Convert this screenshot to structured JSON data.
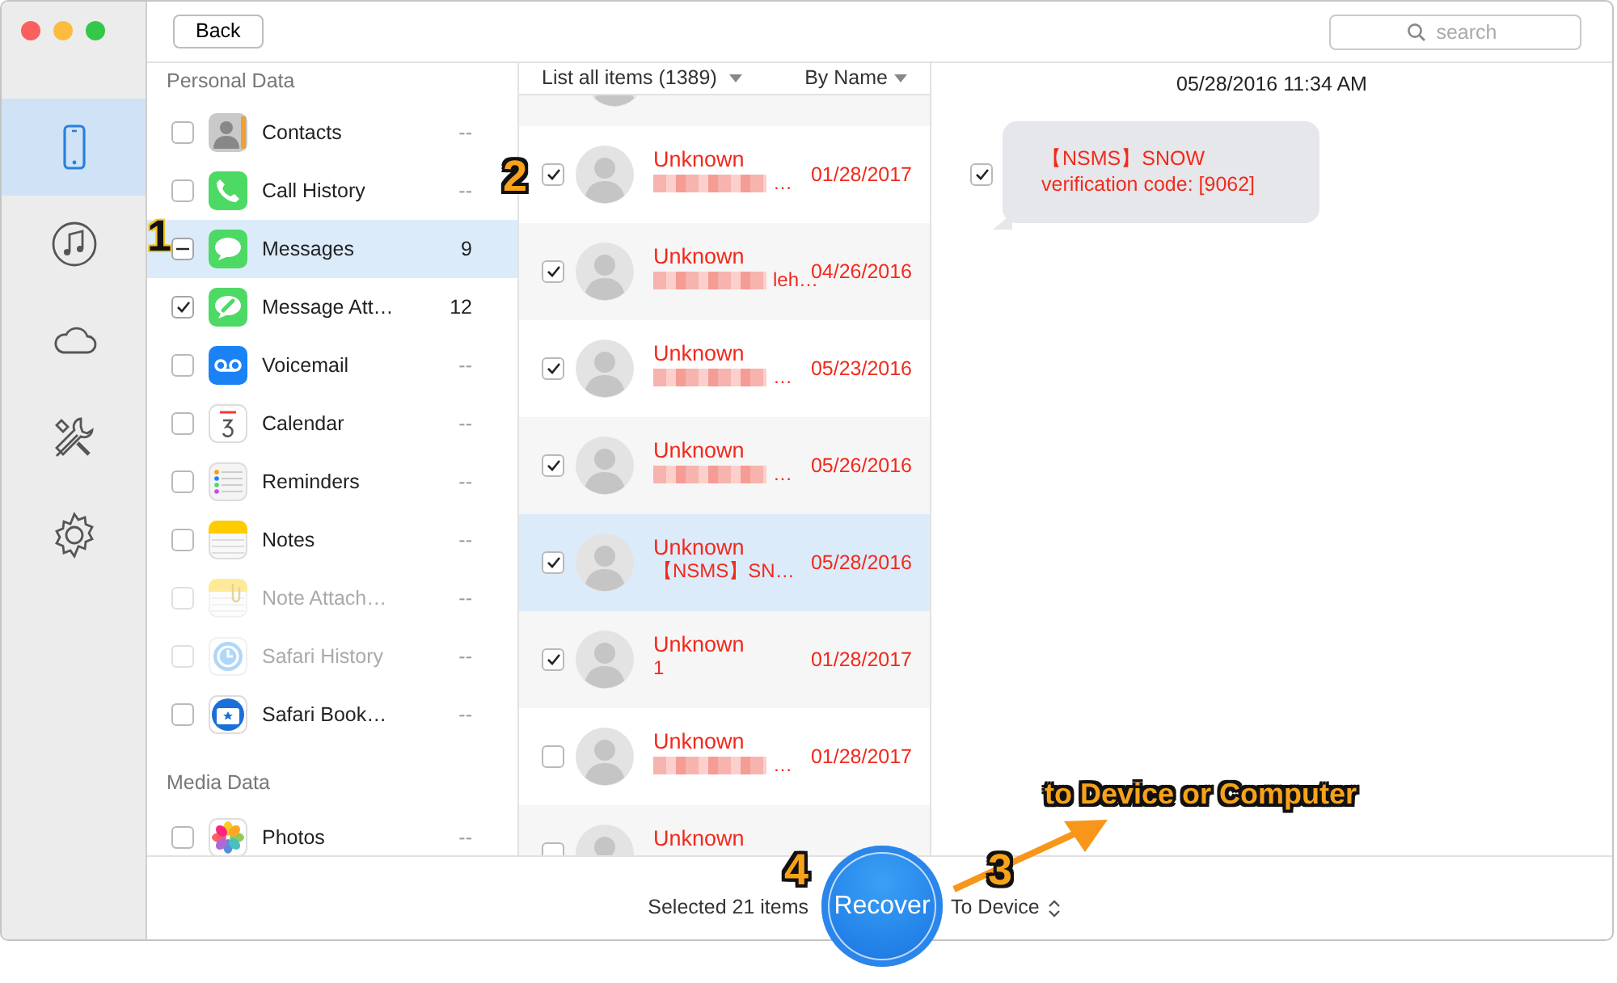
{
  "sidebar": {
    "items": [
      {
        "selected": true
      },
      {
        "selected": false
      },
      {
        "selected": false
      },
      {
        "selected": false
      },
      {
        "selected": false
      }
    ]
  },
  "toolbar": {
    "back_button": "Back",
    "search": {
      "placeholder": "search"
    }
  },
  "categories": {
    "groups": [
      {
        "title": "Personal Data",
        "items": [
          {
            "label": "Contacts",
            "count": "--",
            "checked": false,
            "partial": false,
            "selected": false,
            "disabled": false
          },
          {
            "label": "Call History",
            "count": "--",
            "checked": false,
            "partial": false,
            "selected": false,
            "disabled": false
          },
          {
            "label": "Messages",
            "count": "9",
            "checked": true,
            "partial": true,
            "selected": true,
            "disabled": false
          },
          {
            "label": "Message Att…",
            "count": "12",
            "checked": true,
            "partial": false,
            "selected": false,
            "disabled": false
          },
          {
            "label": "Voicemail",
            "count": "--",
            "checked": false,
            "partial": false,
            "selected": false,
            "disabled": false
          },
          {
            "label": "Calendar",
            "count": "--",
            "checked": false,
            "partial": false,
            "selected": false,
            "disabled": false
          },
          {
            "label": "Reminders",
            "count": "--",
            "checked": false,
            "partial": false,
            "selected": false,
            "disabled": false
          },
          {
            "label": "Notes",
            "count": "--",
            "checked": false,
            "partial": false,
            "selected": false,
            "disabled": false
          },
          {
            "label": "Note Attach…",
            "count": "--",
            "checked": false,
            "partial": false,
            "selected": false,
            "disabled": true
          },
          {
            "label": "Safari History",
            "count": "--",
            "checked": false,
            "partial": false,
            "selected": false,
            "disabled": true
          },
          {
            "label": "Safari Book…",
            "count": "--",
            "checked": false,
            "partial": false,
            "selected": false,
            "disabled": false
          }
        ]
      },
      {
        "title": "Media Data",
        "items": [
          {
            "label": "Photos",
            "count": "--",
            "checked": false,
            "partial": false,
            "selected": false,
            "disabled": false
          }
        ]
      }
    ]
  },
  "message_list": {
    "filter": "List all items (1389)",
    "sort": "By Name",
    "rows": [
      {
        "kind": "cut"
      },
      {
        "kind": "full",
        "checked": true,
        "selected": false,
        "name": "Unknown",
        "redacted": true,
        "preview": "…",
        "date": "01/28/2017"
      },
      {
        "kind": "full",
        "checked": true,
        "selected": false,
        "name": "Unknown",
        "redacted": true,
        "preview": "leh…",
        "date": "04/26/2016"
      },
      {
        "kind": "full",
        "checked": true,
        "selected": false,
        "name": "Unknown",
        "redacted": true,
        "preview": "…",
        "date": "05/23/2016"
      },
      {
        "kind": "full",
        "checked": true,
        "selected": false,
        "name": "Unknown",
        "redacted": true,
        "preview": "…",
        "date": "05/26/2016"
      },
      {
        "kind": "full",
        "checked": true,
        "selected": true,
        "name": "Unknown",
        "redacted": false,
        "preview": "【NSMS】SN…",
        "date": "05/28/2016"
      },
      {
        "kind": "full",
        "checked": true,
        "selected": false,
        "name": "Unknown",
        "redacted": false,
        "preview": "1",
        "date": "01/28/2017"
      },
      {
        "kind": "full",
        "checked": false,
        "selected": false,
        "name": "Unknown",
        "redacted": true,
        "preview": "…",
        "date": "01/28/2017"
      },
      {
        "kind": "full",
        "checked": false,
        "selected": false,
        "name": "Unknown",
        "redacted": false
      }
    ]
  },
  "detail": {
    "timestamp": "05/28/2016 11:34 AM",
    "messages": [
      {
        "checked": true,
        "lines": [
          "【NSMS】SNOW",
          "verification code: [9062]"
        ]
      }
    ]
  },
  "footer": {
    "selection": "Selected 21 items",
    "recover_button": "Recover",
    "destination": "To Device"
  },
  "annotations": [
    {
      "text": "1"
    },
    {
      "text": "2"
    },
    {
      "text": "3"
    },
    {
      "text": "4"
    },
    {
      "text": "to Device or Computer"
    }
  ]
}
